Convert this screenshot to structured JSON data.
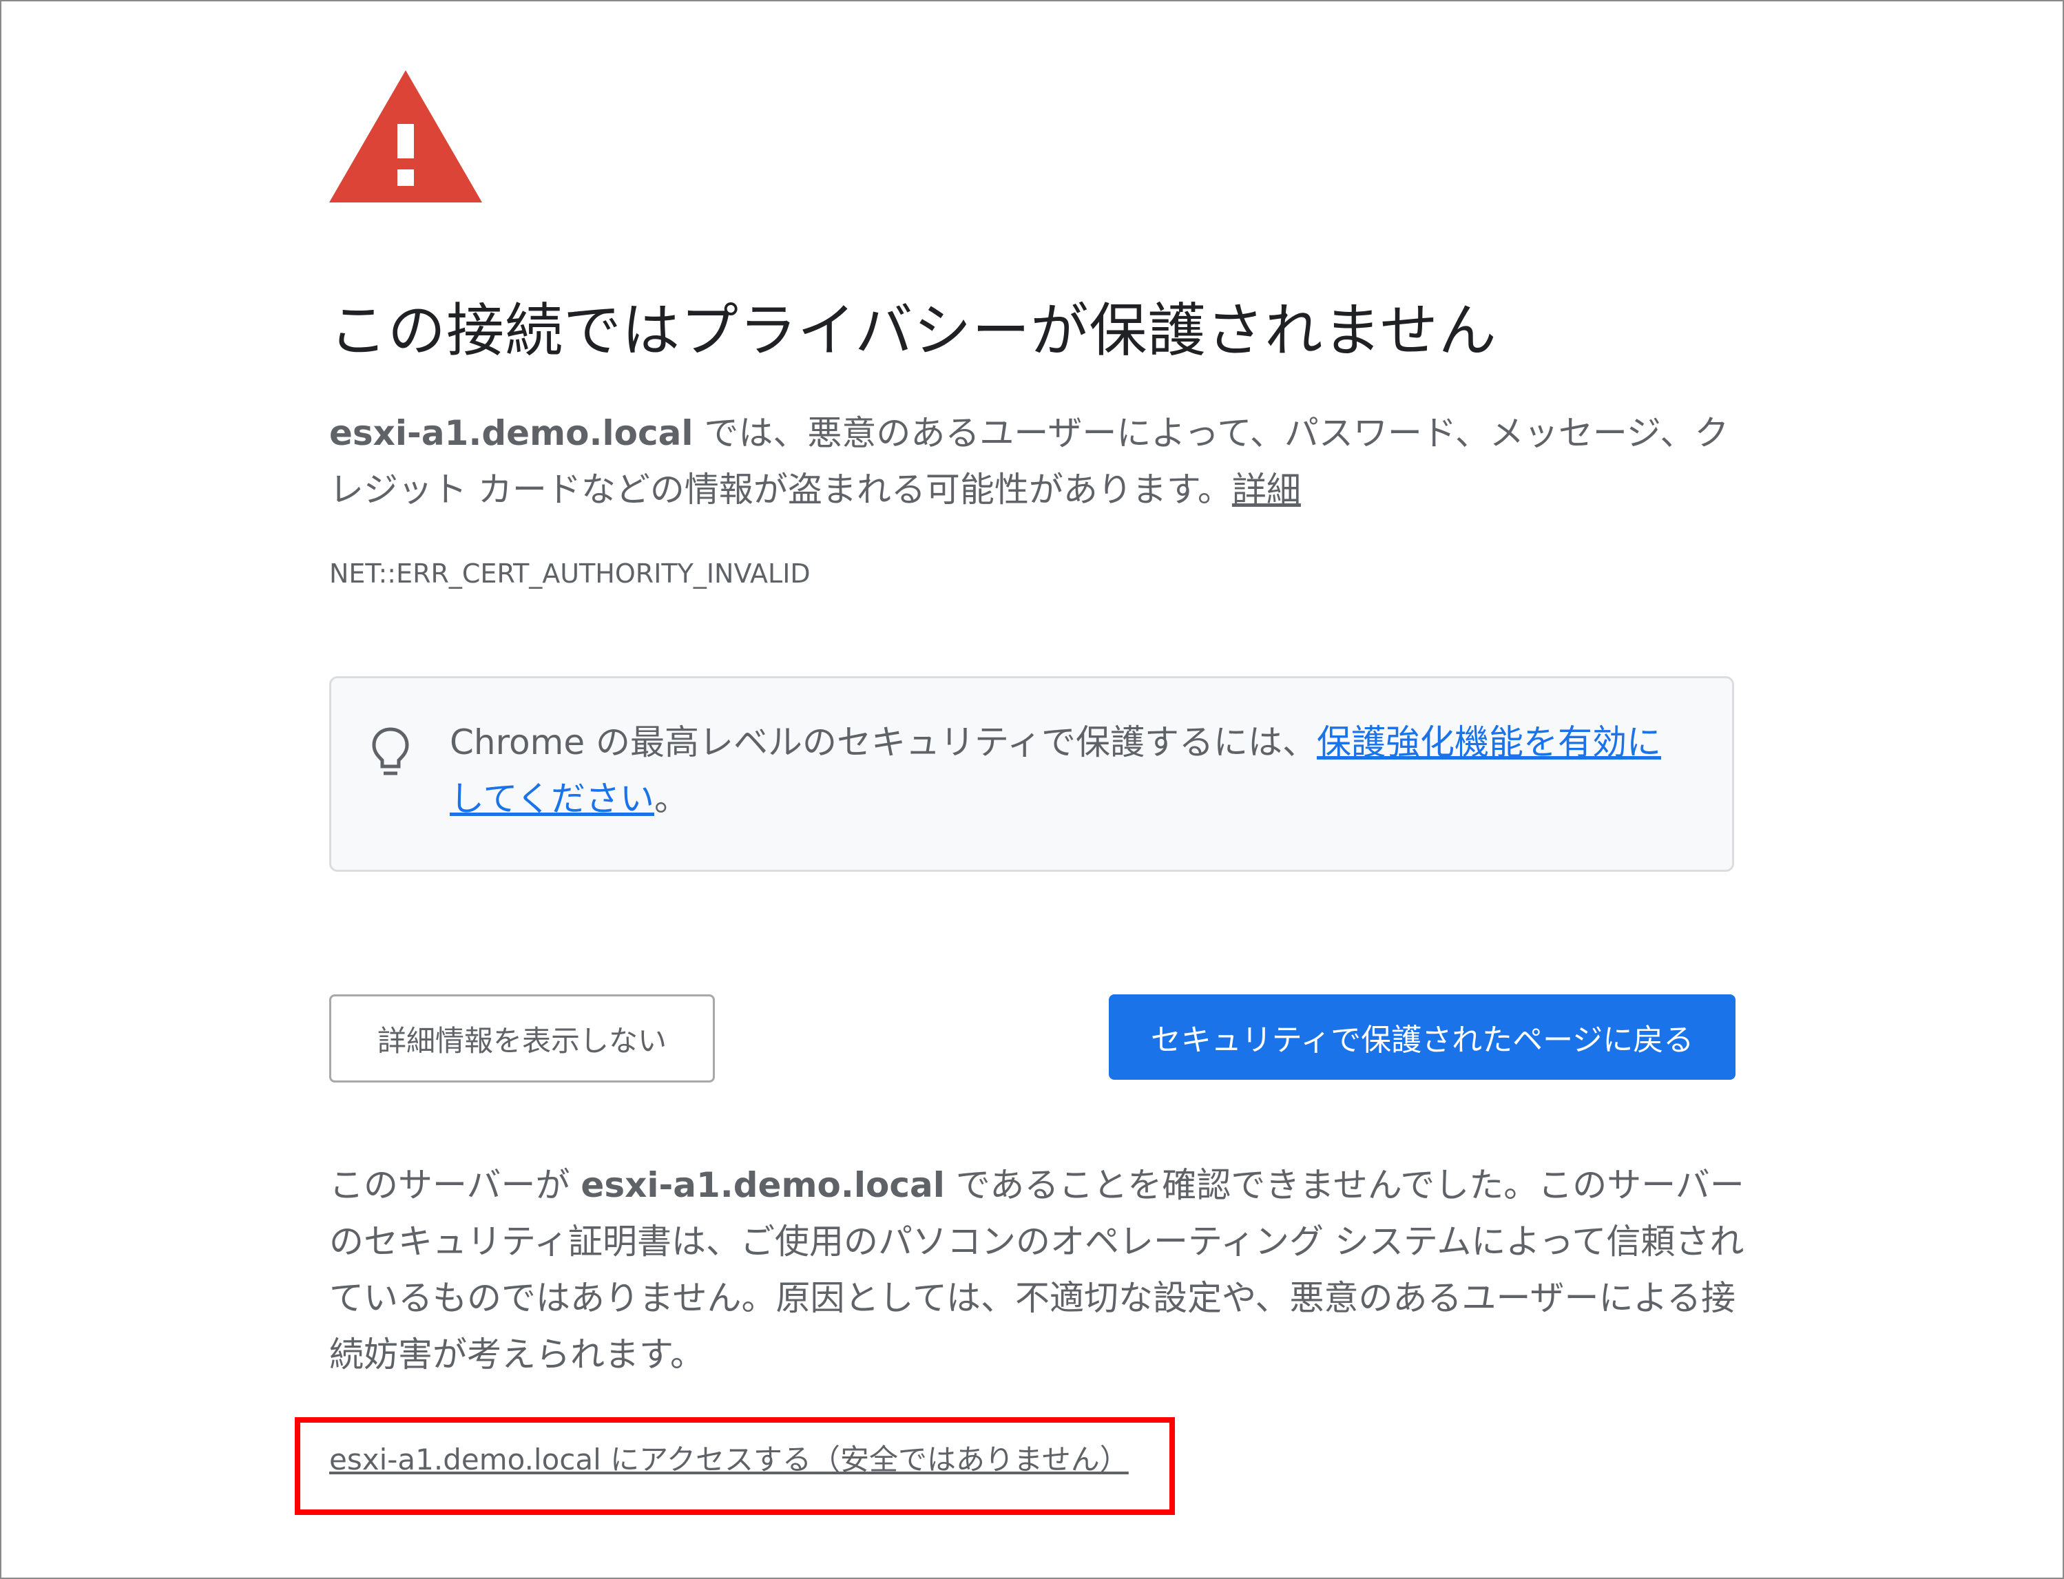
{
  "interstitial": {
    "title": "この接続ではプライバシーが保護されません",
    "explanation": {
      "host": "esxi-a1.demo.local",
      "text": " では、悪意のあるユーザーによって、パスワード、メッセージ、クレジット カードなどの情報が盗まれる可能性があります。",
      "details_link": "詳細"
    },
    "error_code": "NET::ERR_CERT_AUTHORITY_INVALID",
    "enhanced_protection": {
      "icon": "lightbulb-icon",
      "text": "Chrome の最高レベルのセキュリティで保護するには、",
      "link": "保護強化機能を有効にしてください",
      "suffix": "。"
    },
    "buttons": {
      "hide_details": "詳細情報を表示しない",
      "back_to_safety": "セキュリティで保護されたページに戻る"
    },
    "details": {
      "prefix": "このサーバーが ",
      "host": "esxi-a1.demo.local",
      "text": " であることを確認できませんでした。このサーバーのセキュリティ証明書は、ご使用のパソコンのオペレーティング システムによって信頼されているものではありません。原因としては、不適切な設定や、悪意のあるユーザーによる接続妨害が考えられます。"
    },
    "proceed_link": "esxi-a1.demo.local にアクセスする（安全ではありません）"
  },
  "colors": {
    "warning_red": "#db4437",
    "primary_blue": "#1a73e8",
    "highlight_red": "#ff0000",
    "secondary_text": "#5f6368"
  }
}
